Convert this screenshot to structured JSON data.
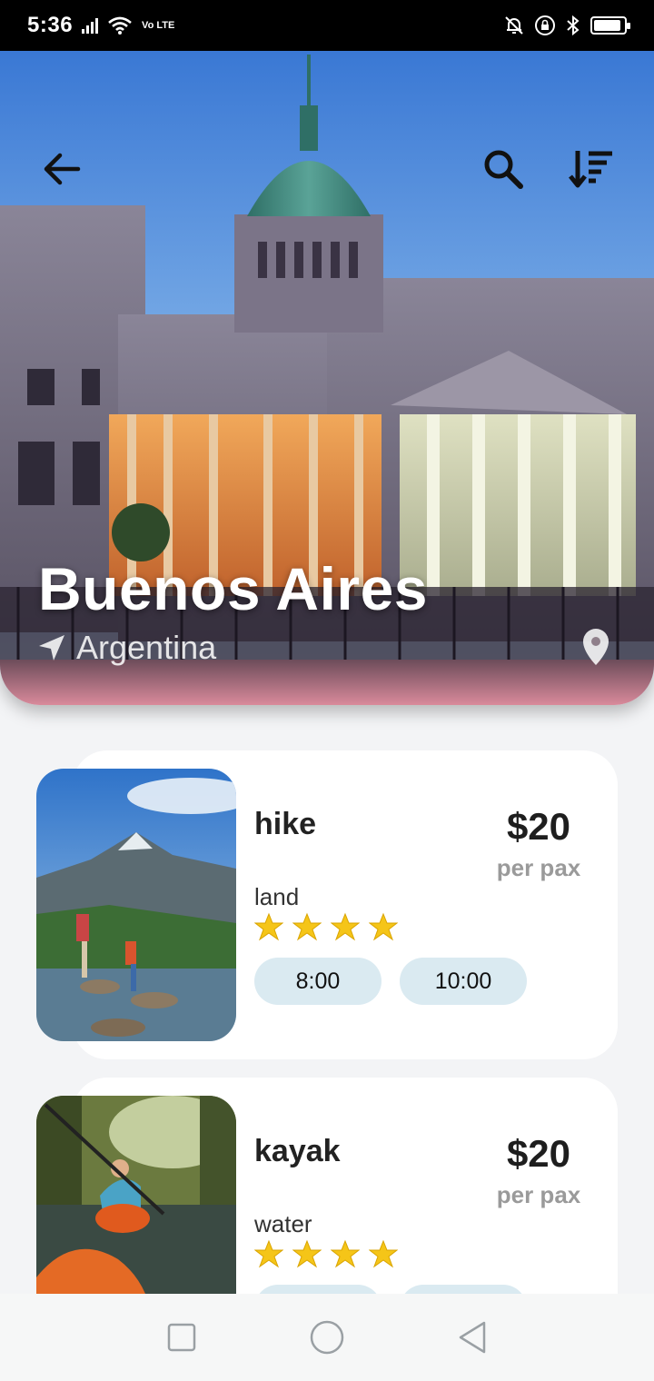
{
  "status": {
    "time": "5:36",
    "volte": "Vo LTE"
  },
  "hero": {
    "city": "Buenos Aires",
    "country": "Argentina"
  },
  "activities": [
    {
      "name": "hike",
      "category": "land",
      "price": "$20",
      "price_unit": "per pax",
      "rating": 4,
      "times": [
        "8:00",
        "10:00"
      ]
    },
    {
      "name": "kayak",
      "category": "water",
      "price": "$20",
      "price_unit": "per pax",
      "rating": 4,
      "times": []
    }
  ],
  "icons": {
    "back": "arrow-left-icon",
    "search": "search-icon",
    "sort": "sort-icon",
    "location": "location-arrow-icon",
    "pin": "map-pin-icon",
    "nav_recents": "square-icon",
    "nav_home": "circle-icon",
    "nav_back": "triangle-back-icon"
  },
  "colors": {
    "chip": "#daeaf1",
    "star": "#f5c518",
    "card": "#ffffff",
    "background": "#f3f4f6"
  }
}
